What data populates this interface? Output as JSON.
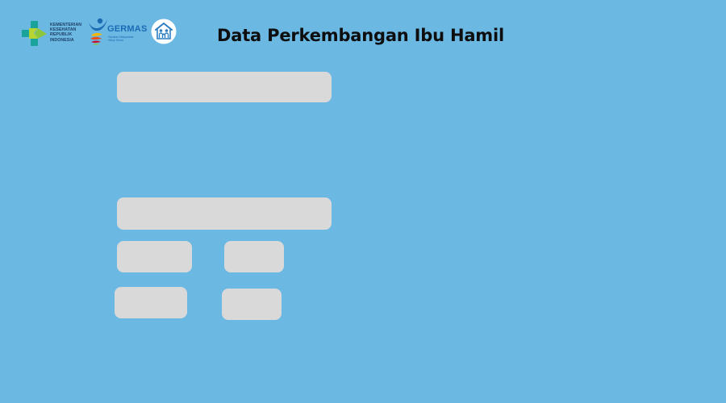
{
  "header": {
    "title": "Data Perkembangan Ibu Hamil",
    "logos": {
      "kemenkes": {
        "icon": "kemenkes-logo-icon",
        "lines": [
          "KEMENTERIAN",
          "KESEHATAN",
          "REPUBLIK",
          "INDONESIA"
        ]
      },
      "germas": {
        "icon": "germas-logo-icon",
        "word": "GERMAS",
        "tagline": "Gerakan Masyarakat Hidup Sehat"
      },
      "posyandu": {
        "icon": "posyandu-family-icon"
      }
    }
  },
  "form": {
    "fields": [
      {
        "name": "field-1",
        "value": ""
      },
      {
        "name": "field-2",
        "value": ""
      },
      {
        "name": "field-3",
        "value": ""
      },
      {
        "name": "field-4",
        "value": ""
      },
      {
        "name": "field-5",
        "value": ""
      },
      {
        "name": "field-6",
        "value": ""
      }
    ]
  },
  "colors": {
    "background": "#6bb8e3",
    "field": "#d9d9d9",
    "title": "#0e0e0e"
  }
}
